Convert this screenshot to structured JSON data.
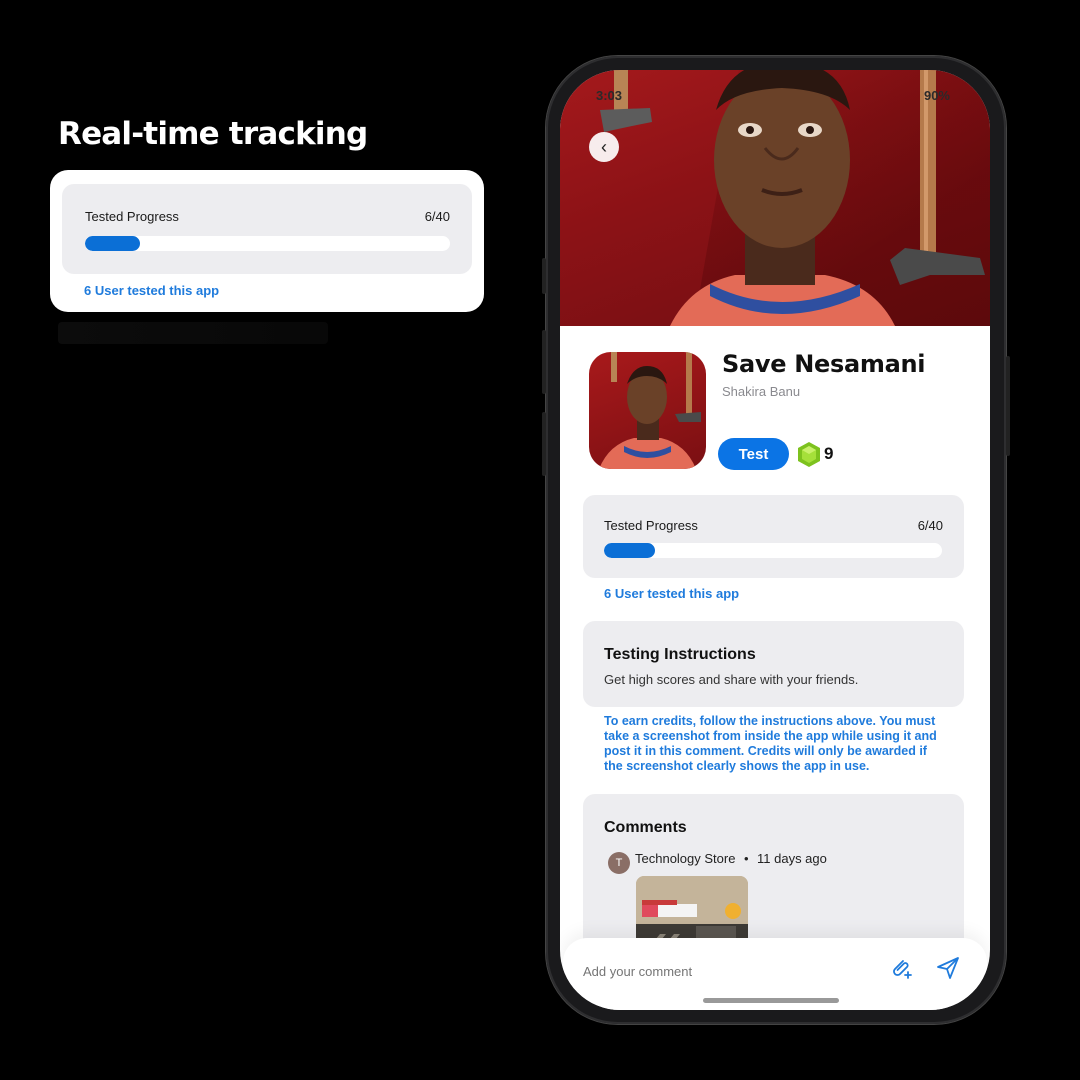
{
  "promo": {
    "title": "Real-time tracking",
    "progress_label": "Tested Progress",
    "progress_count": "6/40",
    "progress_fraction": 0.15,
    "users_tested": "6 User tested this app"
  },
  "status_bar": {
    "time": "3:03",
    "battery": "90%"
  },
  "app": {
    "name": "Save Nesamani",
    "author": "Shakira Banu",
    "test_label": "Test",
    "gem_count": "9"
  },
  "progress": {
    "label": "Tested Progress",
    "count": "6/40",
    "fraction": 0.15,
    "users_tested": "6 User tested this app"
  },
  "instructions": {
    "title": "Testing Instructions",
    "text": "Get high scores and share with your friends.",
    "notice": "To earn credits, follow the instructions above. You must take a screenshot from inside the app while using it and post it in this comment. Credits will only be awarded if the screenshot clearly shows the app in use."
  },
  "comments": {
    "title": "Comments",
    "items": [
      {
        "avatar_letter": "T",
        "author": "Technology Store",
        "separator": "•",
        "time": "11 days ago"
      }
    ]
  },
  "composer": {
    "placeholder": "Add your comment"
  },
  "colors": {
    "accent": "#0b74e5",
    "link": "#1f7bdc",
    "hero_red": "#a4191c",
    "card_bg": "#ededf0",
    "gem_green": "#7dc21e"
  }
}
